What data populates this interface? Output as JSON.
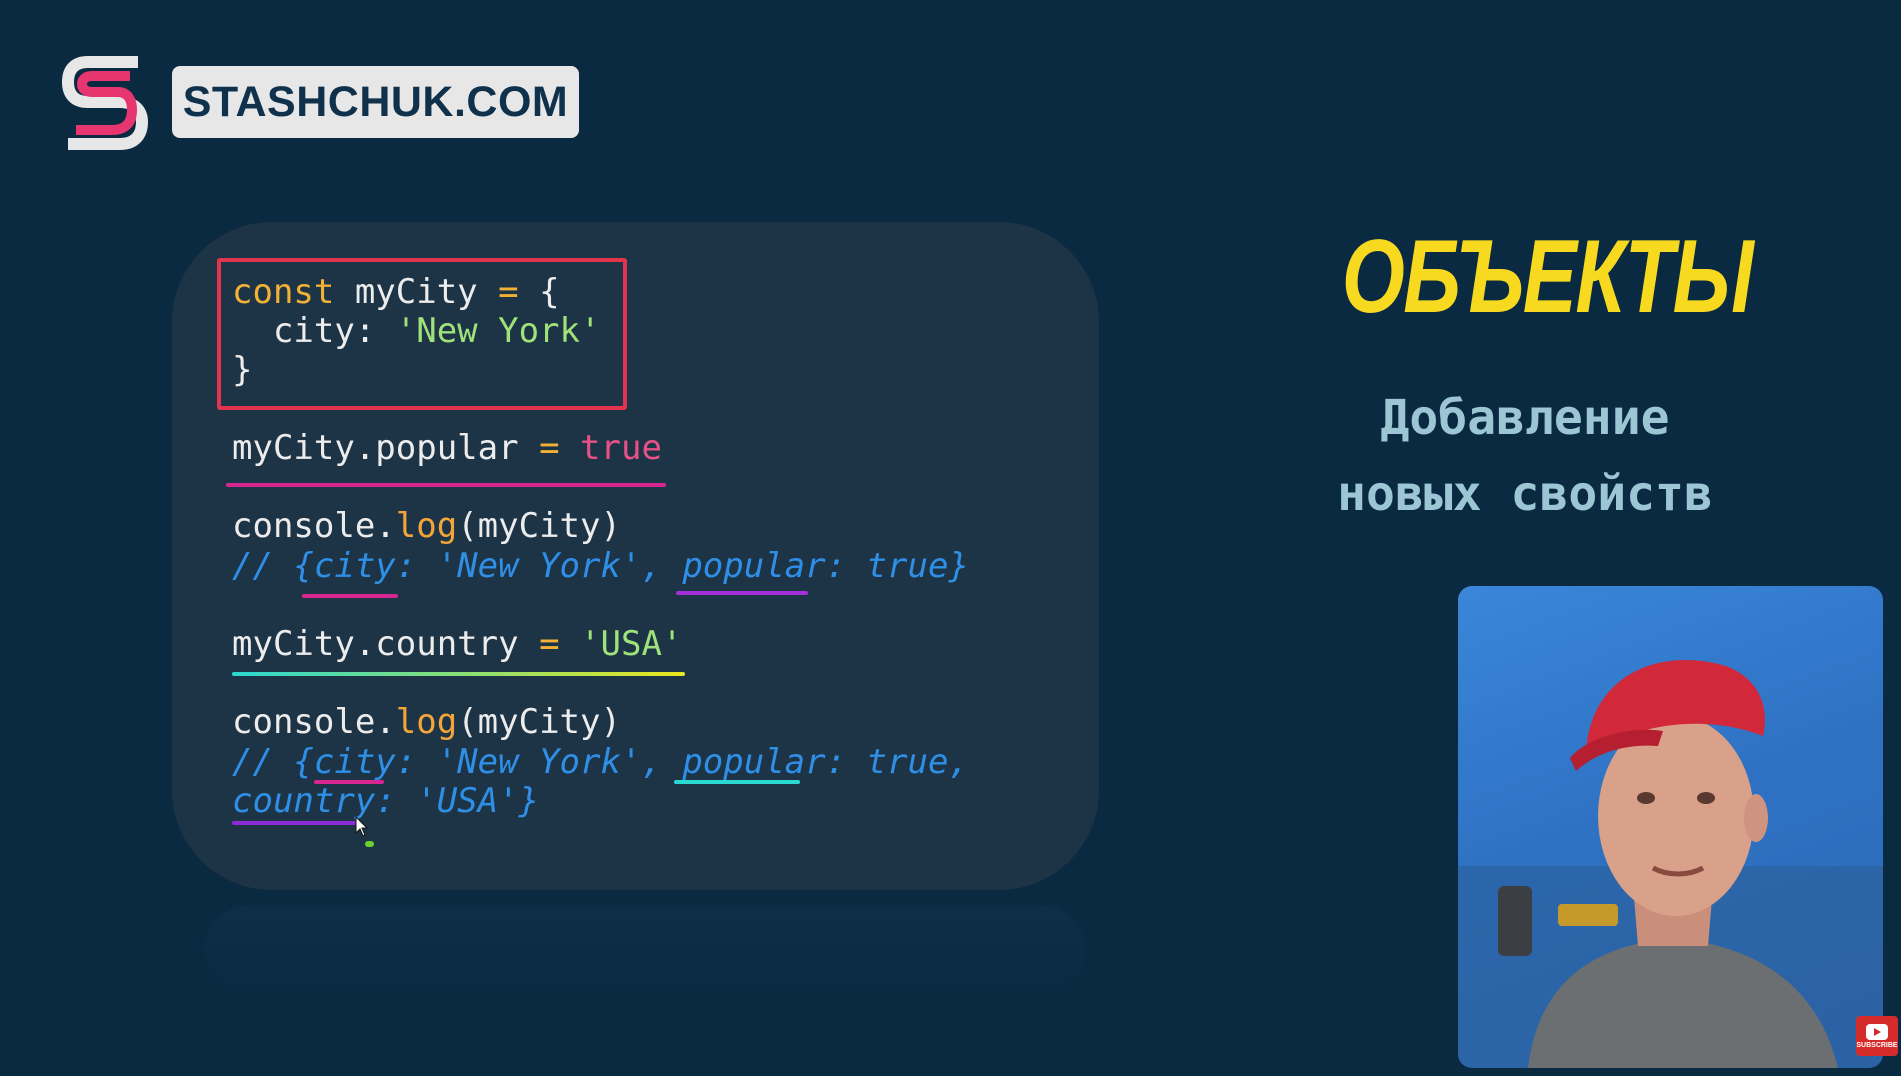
{
  "brand": {
    "name": "STASHCHUK.COM",
    "colors": {
      "accent": "#e6356f",
      "mark_outline": "#e7e7e8",
      "badge_bg": "#e7e7e8",
      "badge_text": "#10314b"
    }
  },
  "slide": {
    "title": "ОБЪЕКТЫ",
    "subtitle_line1": "Добавление",
    "subtitle_line2": "новых свойств",
    "title_color": "#f7da1f",
    "subtitle_color": "#9cc6d4",
    "background": "#0a2a42"
  },
  "code": {
    "block": {
      "l1_kw": "const",
      "l1_rest": " myCity ",
      "l1_op": "=",
      "l1_brace": " {",
      "l2_key": "  city: ",
      "l2_str": "'New York'",
      "l3": "}"
    },
    "line_popular": {
      "target": "myCity.popular",
      "op": "=",
      "value": "true"
    },
    "log1": {
      "obj": "console.",
      "fn": "log",
      "args": "(myCity)"
    },
    "comment1": "// {city: 'New York', popular: true}",
    "line_country": {
      "target": "myCity.country",
      "op": "=",
      "value": "'USA'"
    },
    "log2": {
      "obj": "console.",
      "fn": "log",
      "args": "(myCity)"
    },
    "comment2_line1": "// {city: 'New York', popular: true,",
    "comment2_line2": "country: 'USA'}"
  },
  "colors": {
    "keyword": "#f2b134",
    "string": "#9fe27a",
    "boolean": "#e85186",
    "comment": "#2f8fe6",
    "highlight_box": "#e2354d",
    "underline_magenta": "#d7268f",
    "underline_teal": "#29d8d0",
    "underline_yellow": "#e9e61f",
    "underline_purple": "#8d2bd6"
  },
  "icons": {
    "logo": "stashchuk-s-logo-icon",
    "cursor": "mouse-cursor-icon",
    "subscribe": "youtube-subscribe-icon"
  },
  "overlay": {
    "subscribe_label": "SUBSCRIBE"
  }
}
